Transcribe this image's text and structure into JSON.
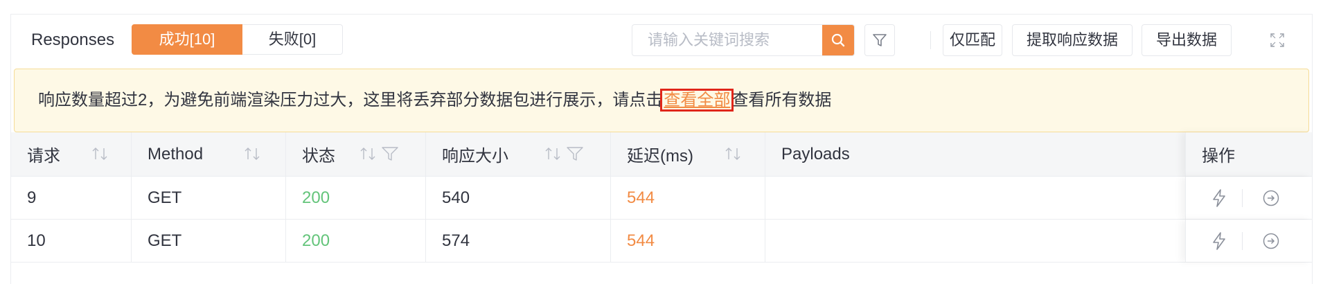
{
  "header": {
    "title": "Responses",
    "tab_success": "成功[10]",
    "tab_fail": "失败[0]",
    "search_placeholder": "请输入关键词搜索",
    "only_match": "仅匹配",
    "extract_data": "提取响应数据",
    "export_data": "导出数据"
  },
  "notice": {
    "prefix": "响应数量超过2，为避免前端渲染压力过大，这里将丢弃部分数据包进行展示，请点击",
    "link": "查看全部",
    "suffix": "查看所有数据"
  },
  "table": {
    "columns": {
      "request": "请求",
      "method": "Method",
      "status": "状态",
      "size": "响应大小",
      "latency": "延迟(ms)",
      "payloads": "Payloads",
      "actions": "操作"
    },
    "rows": [
      {
        "request": "9",
        "method": "GET",
        "status": "200",
        "size": "540",
        "latency": "544",
        "payloads": ""
      },
      {
        "request": "10",
        "method": "GET",
        "status": "200",
        "size": "574",
        "latency": "544",
        "payloads": ""
      }
    ]
  },
  "colors": {
    "accent": "#f28b44",
    "status_ok": "#63c47a",
    "notice_bg": "#fef9e6",
    "highlight_box": "#e0261a"
  },
  "icons": [
    "search-icon",
    "filter-icon",
    "fullscreen-icon",
    "sort-icon",
    "lightning-icon",
    "arrow-right-circle-icon"
  ]
}
